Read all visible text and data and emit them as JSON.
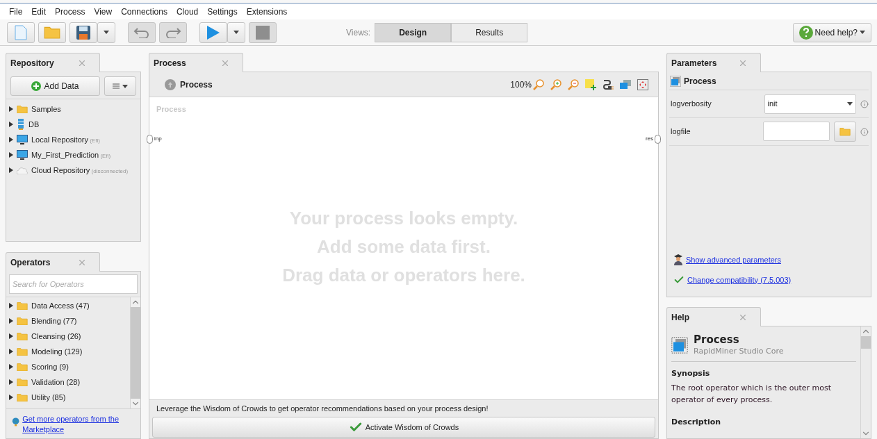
{
  "menu": [
    "File",
    "Edit",
    "Process",
    "View",
    "Connections",
    "Cloud",
    "Settings",
    "Extensions"
  ],
  "toolbar": {
    "views_label": "Views:",
    "views": [
      {
        "label": "Design",
        "selected": true
      },
      {
        "label": "Results",
        "selected": false
      }
    ],
    "help_button": "Need help?"
  },
  "repository": {
    "title": "Repository",
    "add_button": "Add Data",
    "items": [
      {
        "kind": "folder",
        "label": "Samples"
      },
      {
        "kind": "database",
        "label": "DB"
      },
      {
        "kind": "monitor",
        "label": "Local Repository",
        "note": "(Efi)"
      },
      {
        "kind": "monitor",
        "label": "My_First_Prediction",
        "note": "(Efi)"
      },
      {
        "kind": "cloud",
        "label": "Cloud Repository",
        "note": "(disconnected)"
      }
    ]
  },
  "operators": {
    "title": "Operators",
    "search_placeholder": "Search for Operators",
    "items": [
      "Data Access (47)",
      "Blending (77)",
      "Cleansing (26)",
      "Modeling (129)",
      "Scoring (9)",
      "Validation (28)",
      "Utility (85)"
    ],
    "marketplace_link": "Get more operators from the Marketplace"
  },
  "process": {
    "title": "Process",
    "breadcrumb": "Process",
    "zoom": "100%",
    "canvas_label": "Process",
    "input_port": "inp",
    "output_port": "res",
    "empty_lines": [
      "Your process looks empty.",
      "Add some data first.",
      "Drag data or operators here."
    ],
    "wisdom_text": "Leverage the Wisdom of Crowds to get operator recommendations based on your process design!",
    "wisdom_button": "Activate Wisdom of Crowds"
  },
  "parameters": {
    "title": "Parameters",
    "operator": "Process",
    "params": [
      {
        "kind": "select",
        "label": "logverbosity",
        "value": "init"
      },
      {
        "kind": "file",
        "label": "logfile"
      }
    ],
    "links": [
      {
        "kind": "advanced",
        "text": "Show advanced parameters"
      },
      {
        "kind": "compatibility",
        "text": "Change compatibility (7.5.003)"
      }
    ]
  },
  "help": {
    "title": "Help",
    "operator": "Process",
    "source": "RapidMiner Studio Core",
    "sections": [
      {
        "heading": "Synopsis",
        "body": "The root operator which is the outer most operator of every process."
      },
      {
        "heading": "Description"
      }
    ]
  }
}
